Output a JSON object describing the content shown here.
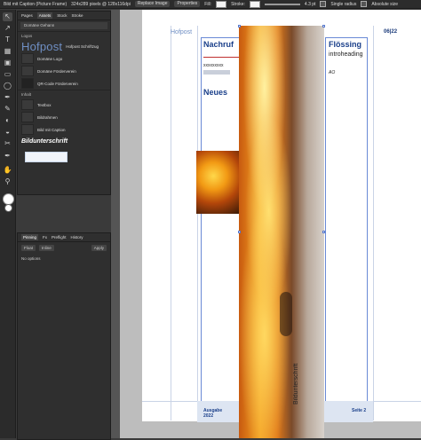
{
  "topbar": {
    "doc_info": "Bild mit Caption (Picture Frame)",
    "pixels": "324x289 pixels @ 128x116dpi",
    "replace_image": "Replace Image",
    "properties": "Properties",
    "fill_label": "Fill:",
    "stroke_label": "Stroke:",
    "stroke_value": "4.3 pt",
    "single_radius": "Single radius",
    "absolute_size": "Absolute size"
  },
  "assets_panel": {
    "tabs": [
      "Pages",
      "Assets",
      "Stock",
      "Stroke"
    ],
    "active_tab": "Assets",
    "selector": "Domäne Gehann",
    "sections": [
      {
        "title": "Logos",
        "items": [
          {
            "thumb_text": "Hofpost",
            "label": "Hofpost Schriftzug"
          },
          {
            "label": "Domäne Logo"
          },
          {
            "label": "Domäne Förderverein"
          },
          {
            "label": "QR-Code Förderverein"
          }
        ]
      },
      {
        "title": "Inhalt",
        "items": [
          {
            "label": "Textbox"
          },
          {
            "label": "Bildrahmen"
          },
          {
            "label": "Bild mit Caption"
          }
        ]
      }
    ],
    "caption_asset": "Bildunterschrift"
  },
  "bottom_panel": {
    "tabs": [
      "Pinning",
      "Fx",
      "Preflight",
      "History"
    ],
    "active_tab": "Pinning",
    "float": "Float",
    "inline": "Inline",
    "apply": "Apply",
    "status": "No options"
  },
  "document": {
    "hofpost": "Hofpost",
    "page_num_top": "06|22",
    "heading_left": "Nachruf",
    "heading_right": "Flössing",
    "intro": "introheading",
    "ao": "AO",
    "placeholder_x": "xxxxxxxxx",
    "neues": "Neues",
    "footer_ausgabe": "Ausgabe",
    "footer_year": "2022",
    "footer_seite": "Seite 2",
    "footer_caption": "Bildunterschrift"
  },
  "colors": {
    "heading_blue": "#1a3f8a",
    "logo_blue": "#6f8fc4",
    "selection": "#6a8ad6"
  },
  "icons": {
    "tools": [
      "move-tool-icon",
      "node-tool-icon",
      "frame-text-tool-icon",
      "table-tool-icon",
      "picture-frame-icon",
      "rectangle-tool-icon",
      "ellipse-tool-icon",
      "pen-tool-icon",
      "pencil-tool-icon",
      "fill-tool-icon",
      "transparency-tool-icon",
      "view-tool-icon",
      "zoom-tool-icon",
      "color-picker-icon"
    ]
  }
}
